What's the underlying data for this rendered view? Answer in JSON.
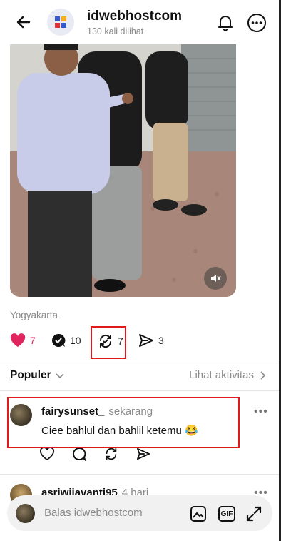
{
  "header": {
    "title": "idwebhostcom",
    "views": "130 kali dilihat"
  },
  "post": {
    "location": "Yogyakarta",
    "stats": {
      "likes": "7",
      "replies": "10",
      "reposts": "7",
      "shares": "3"
    }
  },
  "comments_section": {
    "sort_label": "Populer",
    "activity_label": "Lihat aktivitas"
  },
  "comments": [
    {
      "username": "fairysunset_",
      "time": "sekarang",
      "text": "Ciee bahlul dan bahlil ketemu 😂"
    },
    {
      "username": "asriwiiavanti95",
      "time": "4 hari"
    }
  ],
  "reply_bar": {
    "placeholder": "Balas idwebhostcom",
    "gif_label": "GIF"
  },
  "colors": {
    "like": "#e0245e",
    "highlight": "#e01a1a"
  }
}
